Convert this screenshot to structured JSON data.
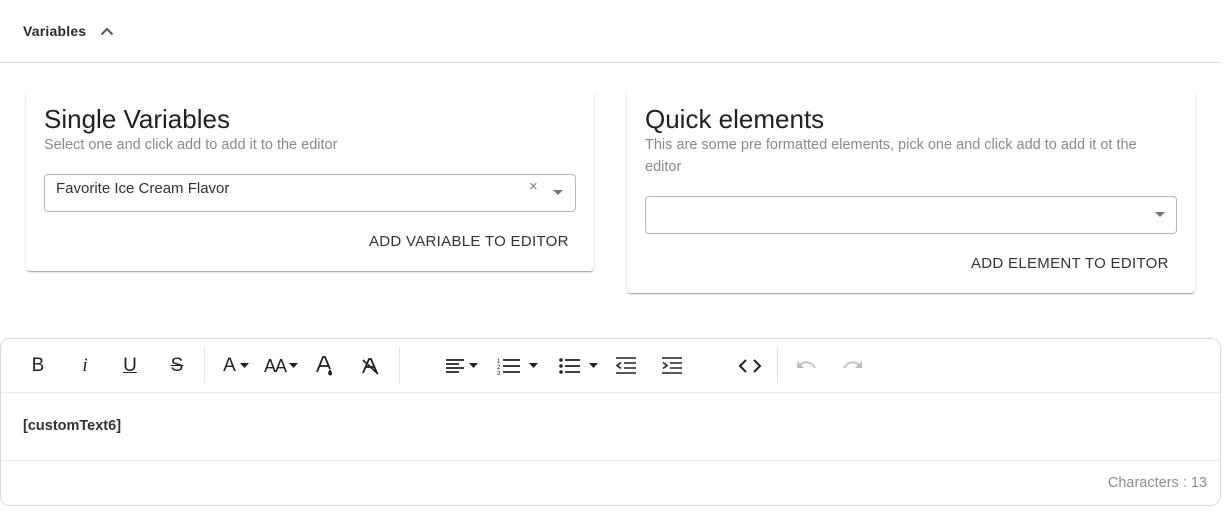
{
  "header": {
    "title": "Variables",
    "collapse_icon": "chevron-up-icon"
  },
  "single_variables": {
    "title": "Single Variables",
    "subtitle": "Select one and click add to add it to the editor",
    "select_value": "Favorite Ice Cream Flavor",
    "clear_symbol": "×",
    "add_button": "ADD VARIABLE TO EDITOR"
  },
  "quick_elements": {
    "title": "Quick elements",
    "subtitle_line1": "This are some pre formatted elements, pick one and click add to add it ot the",
    "subtitle_line2": "editor",
    "select_value": "",
    "add_button": "ADD ELEMENT TO EDITOR"
  },
  "toolbar": {
    "bold": "B",
    "italic": "i",
    "underline": "U",
    "strike": "S",
    "font_color": "A",
    "font_size": "AA",
    "icons": [
      "bold-icon",
      "italic-icon",
      "underline-icon",
      "strikethrough-icon",
      "font-color-icon",
      "font-size-icon",
      "highlight-icon",
      "clear-format-icon",
      "align-icon",
      "numbered-list-icon",
      "bullet-list-icon",
      "outdent-icon",
      "indent-icon",
      "code-icon",
      "undo-icon",
      "redo-icon"
    ]
  },
  "editor": {
    "content": "[customText6]",
    "char_count": "Characters : 13"
  }
}
